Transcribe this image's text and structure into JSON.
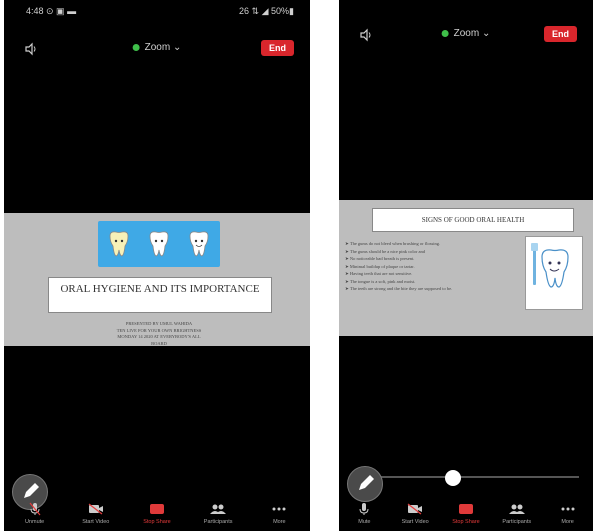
{
  "left_phone": {
    "status_time": "4:48 ⊙ ▣ ▬",
    "status_right": "26 ⇅ ◢ 50%▮",
    "meeting_label": "Zoom",
    "end_label": "End",
    "slide": {
      "title": "ORAL HYGIENE AND ITS IMPORTANCE",
      "presenter_lines": [
        "PRESENTED BY UMUL WAHIDA",
        "TEN LIVE FOR YOUR OWN BRIGHTNESS",
        "MONDAY 14 2020 AT EVERYBODY'S ALL",
        "BOARD"
      ]
    },
    "toolbar": [
      {
        "icon": "mic-off-icon",
        "label": "Unmute"
      },
      {
        "icon": "video-off-icon",
        "label": "Start Video"
      },
      {
        "icon": "share-screen-icon",
        "label": "Stop Share",
        "active": true
      },
      {
        "icon": "participants-icon",
        "label": "Participants"
      },
      {
        "icon": "more-icon",
        "label": "More"
      }
    ]
  },
  "right_phone": {
    "meeting_label": "Zoom",
    "end_label": "End",
    "slide": {
      "title": "SIGNS OF GOOD ORAL HEALTH",
      "points": [
        "➤ The gums do not bleed when brushing or flossing.",
        "➤ The gums should be a nice pink color and",
        "➤ No noticeable bad breath is present.",
        "➤ Minimal buildup of plaque or tartar.",
        "➤ Having teeth that are not sensitive.",
        "➤ The tongue is a soft, pink and moist.",
        "➤ The teeth are strong and the bite they are supposed to be."
      ]
    },
    "progress": 0.37,
    "toolbar": [
      {
        "icon": "mic-icon",
        "label": "Mute"
      },
      {
        "icon": "video-off-icon",
        "label": "Start Video"
      },
      {
        "icon": "share-screen-icon",
        "label": "Stop Share",
        "active": true
      },
      {
        "icon": "participants-icon",
        "label": "Participants"
      },
      {
        "icon": "more-icon",
        "label": "More"
      }
    ]
  },
  "colors": {
    "end_button": "#d9262c",
    "share_active": "#e53b3b",
    "connection_dot": "#3fbf4a",
    "slide_background": "#bdbdbd",
    "teeth_banner": "#3fa9e6"
  }
}
